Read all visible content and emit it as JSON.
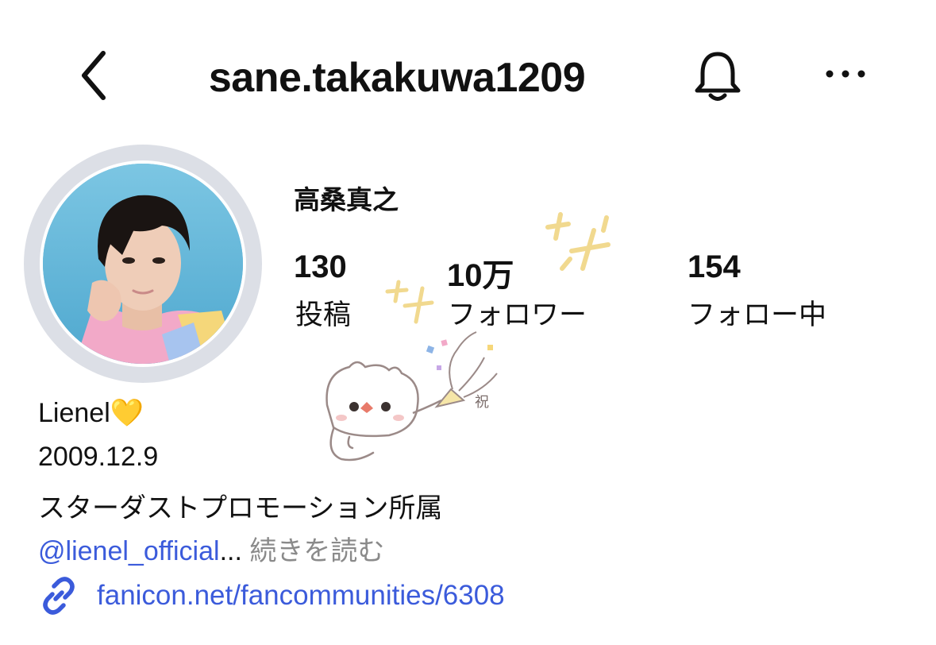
{
  "header": {
    "username": "sane.takakuwa1209",
    "back_icon": "chevron-left-icon",
    "bell_icon": "bell-icon",
    "more_icon": "more-horizontal-icon"
  },
  "profile": {
    "display_name": "高桑真之",
    "stats": [
      {
        "value": "130",
        "label": "投稿"
      },
      {
        "value": "10万",
        "label": "フォロワー"
      },
      {
        "value": "154",
        "label": "フォロー中"
      }
    ],
    "bio": {
      "line1": "Lienel💛",
      "line2": "2009.12.9",
      "line3": "スターダストプロモーション所属",
      "mention": "@lienel_official",
      "ellipsis": "...",
      "read_more": "続きを読む"
    },
    "link": {
      "icon": "link-icon",
      "text": "fanicon.net/fancommunities/6308"
    },
    "sticker_text": "祝"
  },
  "colors": {
    "link_blue": "#3b5bdb",
    "muted_gray": "#8a8a8a",
    "avatar_ring": "#dcdfe6",
    "sparkle_gold": "#f1d98f"
  }
}
